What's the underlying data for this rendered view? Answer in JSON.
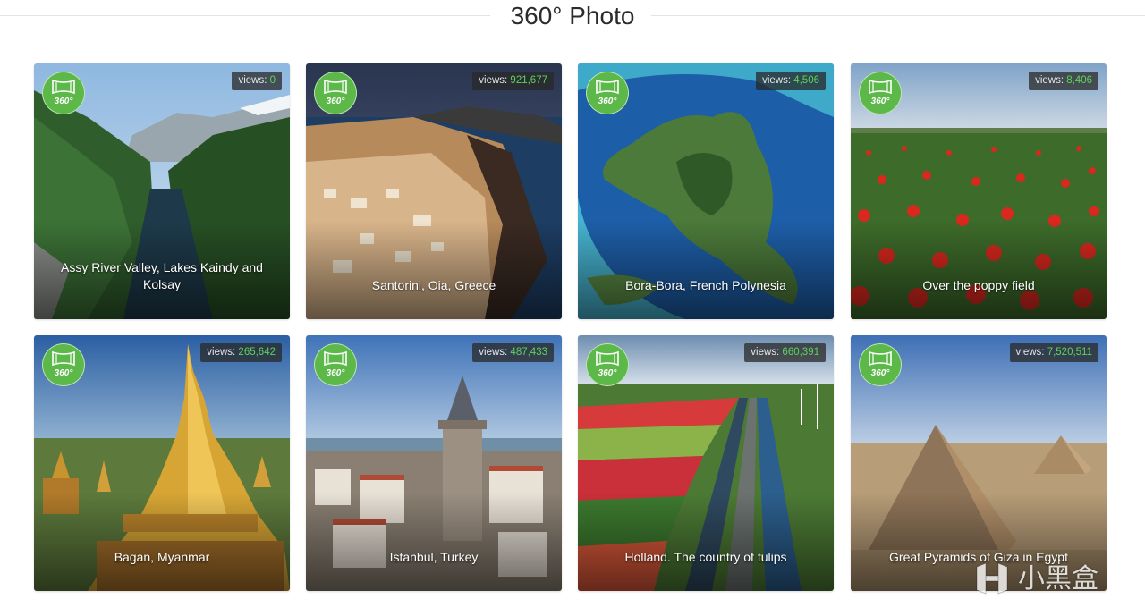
{
  "header": {
    "title": "360° Photo"
  },
  "cards": [
    {
      "title": "Assy River Valley, Lakes Kaindy and Kolsay",
      "views_label": "views:",
      "views": "0",
      "badge_label": "360°"
    },
    {
      "title": "Santorini, Oia, Greece",
      "views_label": "views:",
      "views": "921,677",
      "badge_label": "360°"
    },
    {
      "title": "Bora-Bora, French Polynesia",
      "views_label": "views:",
      "views": "4,506",
      "badge_label": "360°"
    },
    {
      "title": "Over the poppy field",
      "views_label": "views:",
      "views": "8,406",
      "badge_label": "360°"
    },
    {
      "title": "Bagan, Myanmar",
      "views_label": "views:",
      "views": "265,642",
      "badge_label": "360°"
    },
    {
      "title": "Istanbul, Turkey",
      "views_label": "views:",
      "views": "487,433",
      "badge_label": "360°"
    },
    {
      "title": "Holland. The country of tulips",
      "views_label": "views:",
      "views": "660,391",
      "badge_label": "360°"
    },
    {
      "title": "Great Pyramids of Giza in Egypt",
      "views_label": "views:",
      "views": "7,520,511",
      "badge_label": "360°"
    }
  ],
  "watermark": {
    "text": "小黑盒"
  },
  "colors": {
    "badge": "#5cb848",
    "views_number": "#5fd35a"
  }
}
